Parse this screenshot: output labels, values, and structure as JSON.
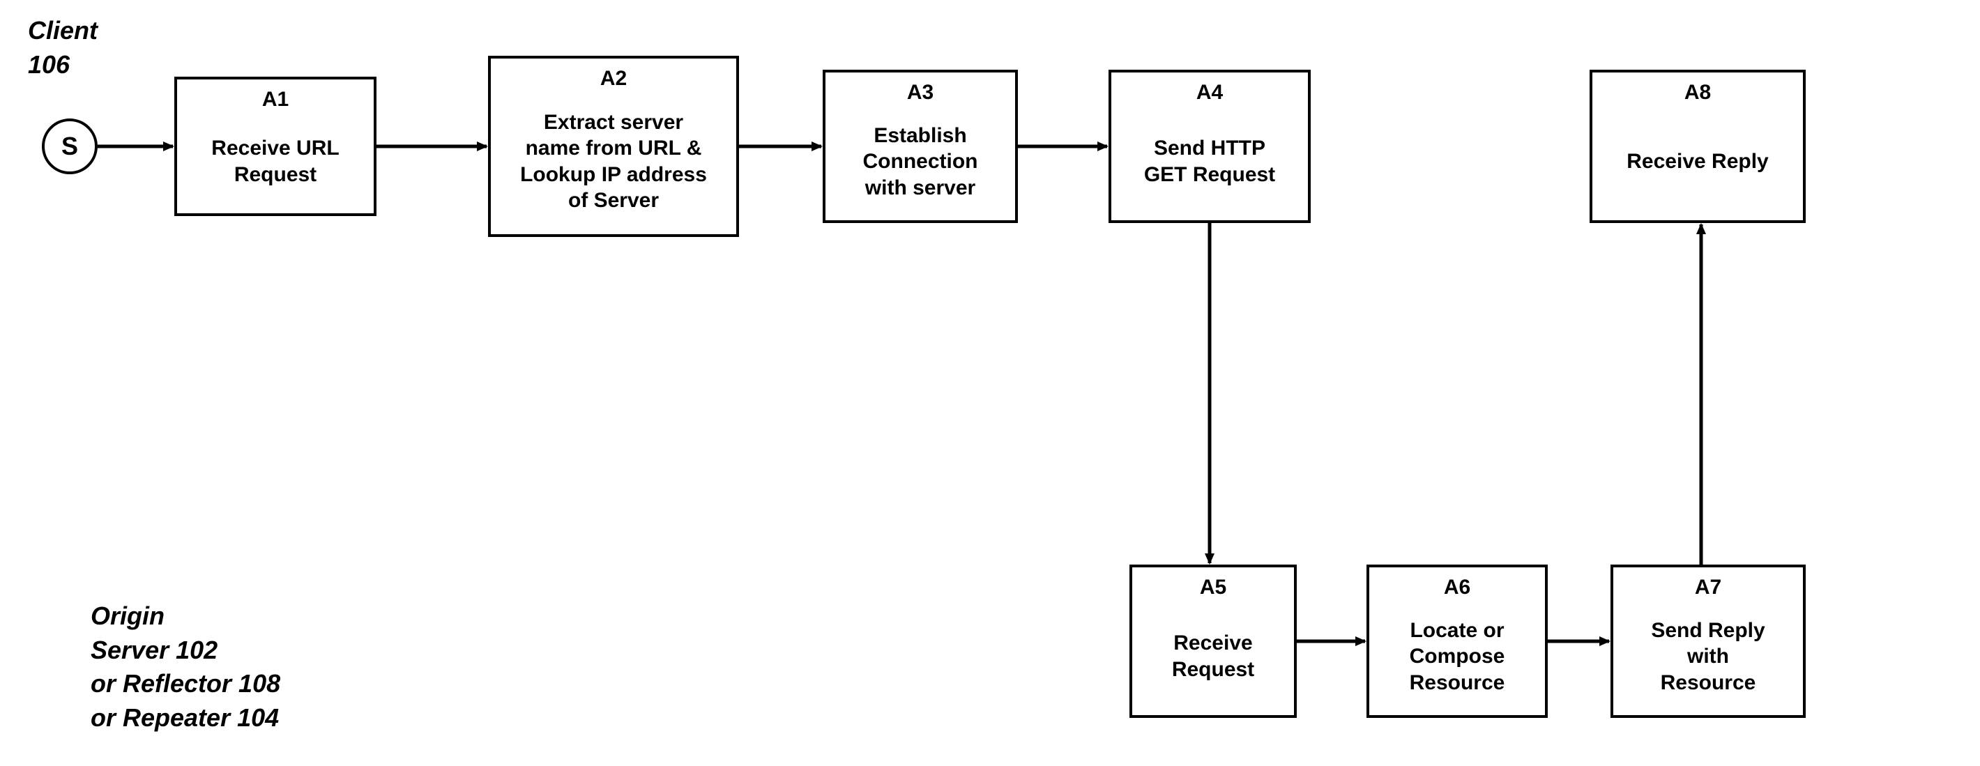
{
  "lanes": {
    "client": "Client\n106",
    "server": "Origin\nServer 102\nor Reflector 108\nor Repeater 104"
  },
  "start": "S",
  "boxes": {
    "a1": {
      "tag": "A1",
      "body": "Receive URL\nRequest"
    },
    "a2": {
      "tag": "A2",
      "body": "Extract server\nname from URL &\nLookup IP address\nof Server"
    },
    "a3": {
      "tag": "A3",
      "body": "Establish\nConnection\nwith server"
    },
    "a4": {
      "tag": "A4",
      "body": "Send HTTP\nGET Request"
    },
    "a5": {
      "tag": "A5",
      "body": "Receive\nRequest"
    },
    "a6": {
      "tag": "A6",
      "body": "Locate or\nCompose\nResource"
    },
    "a7": {
      "tag": "A7",
      "body": "Send Reply\nwith\nResource"
    },
    "a8": {
      "tag": "A8",
      "body": "Receive Reply"
    }
  }
}
